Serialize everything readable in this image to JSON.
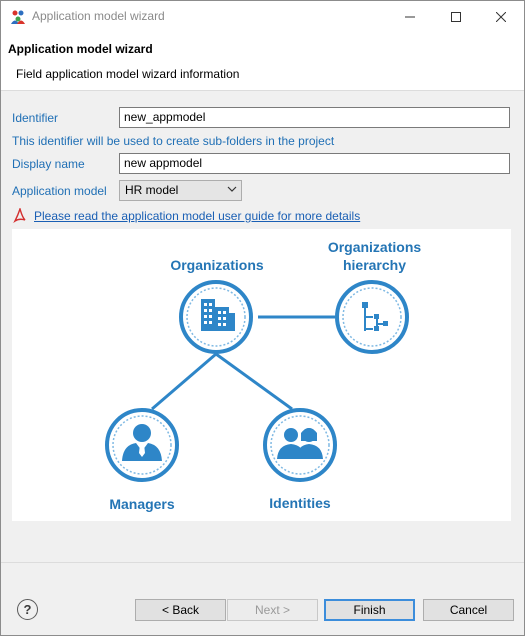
{
  "window": {
    "title": "Application model wizard"
  },
  "header": {
    "title": "Application model wizard",
    "subtitle": "Field application model wizard information"
  },
  "form": {
    "identifier_label": "Identifier",
    "identifier_value": "new_appmodel",
    "identifier_hint": "This identifier will be used to create sub-folders in the project",
    "display_name_label": "Display name",
    "display_name_value": "new appmodel",
    "app_model_label": "Application model",
    "app_model_value": "HR model",
    "guide_link": "Please read the application model user guide for more details"
  },
  "diagram": {
    "organizations": "Organizations",
    "organizations_hierarchy_line1": "Organizations",
    "organizations_hierarchy_line2": "hierarchy",
    "managers": "Managers",
    "identities": "Identities"
  },
  "buttons": {
    "back": "< Back",
    "next": "Next >",
    "finish": "Finish",
    "cancel": "Cancel",
    "help": "?"
  },
  "colors": {
    "accent": "#1f6fb5",
    "diagram_blue": "#2e86c8",
    "default_button_border": "#3c8ddb"
  }
}
